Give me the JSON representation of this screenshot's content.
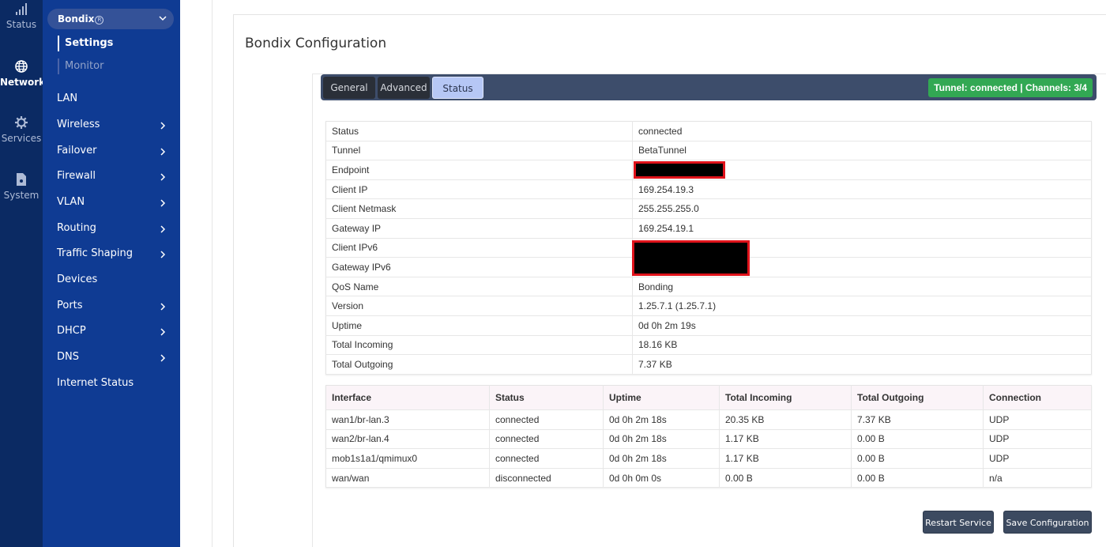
{
  "rail": {
    "items": [
      {
        "label": "Status",
        "icon": "signal-bars-icon"
      },
      {
        "label": "Network",
        "icon": "globe-icon"
      },
      {
        "label": "Services",
        "icon": "gear-icon"
      },
      {
        "label": "System",
        "icon": "file-icon"
      }
    ]
  },
  "sidebar": {
    "group_label": "Bondix",
    "sub_items": [
      {
        "label": "Settings"
      },
      {
        "label": "Monitor"
      }
    ],
    "items": [
      {
        "label": "LAN"
      },
      {
        "label": "Wireless"
      },
      {
        "label": "Failover"
      },
      {
        "label": "Firewall"
      },
      {
        "label": "VLAN"
      },
      {
        "label": "Routing"
      },
      {
        "label": "Traffic Shaping"
      },
      {
        "label": "Devices"
      },
      {
        "label": "Ports"
      },
      {
        "label": "DHCP"
      },
      {
        "label": "DNS"
      },
      {
        "label": "Internet Status"
      }
    ]
  },
  "page": {
    "title": "Bondix Configuration"
  },
  "tabs": [
    {
      "label": "General"
    },
    {
      "label": "Advanced"
    },
    {
      "label": "Status"
    }
  ],
  "tunnel_badge": "Tunnel: connected | Channels: 3/4",
  "status_table": [
    {
      "key": "Status",
      "value": "connected"
    },
    {
      "key": "Tunnel",
      "value": "BetaTunnel"
    },
    {
      "key": "Endpoint",
      "value": ""
    },
    {
      "key": "Client IP",
      "value": "169.254.19.3"
    },
    {
      "key": "Client Netmask",
      "value": "255.255.255.0"
    },
    {
      "key": "Gateway IP",
      "value": "169.254.19.1"
    },
    {
      "key": "Client IPv6",
      "value": ""
    },
    {
      "key": "Gateway IPv6",
      "value": ""
    },
    {
      "key": "QoS Name",
      "value": "Bonding"
    },
    {
      "key": "Version",
      "value": "1.25.7.1 (1.25.7.1)"
    },
    {
      "key": "Uptime",
      "value": "0d 0h 2m 19s"
    },
    {
      "key": "Total Incoming",
      "value": "18.16 KB"
    },
    {
      "key": "Total Outgoing",
      "value": "7.37 KB"
    }
  ],
  "iface_table": {
    "headers": [
      "Interface",
      "Status",
      "Uptime",
      "Total Incoming",
      "Total Outgoing",
      "Connection"
    ],
    "rows": [
      [
        "wan1/br-lan.3",
        "connected",
        "0d 0h 2m 18s",
        "20.35 KB",
        "7.37 KB",
        "UDP"
      ],
      [
        "wan2/br-lan.4",
        "connected",
        "0d 0h 2m 18s",
        "1.17 KB",
        "0.00 B",
        "UDP"
      ],
      [
        "mob1s1a1/qmimux0",
        "connected",
        "0d 0h 2m 18s",
        "1.17 KB",
        "0.00 B",
        "UDP"
      ],
      [
        "wan/wan",
        "disconnected",
        "0d 0h 0m 0s",
        "0.00 B",
        "0.00 B",
        "n/a"
      ]
    ]
  },
  "buttons": {
    "restart": "Restart Service",
    "save": "Save Configuration"
  }
}
